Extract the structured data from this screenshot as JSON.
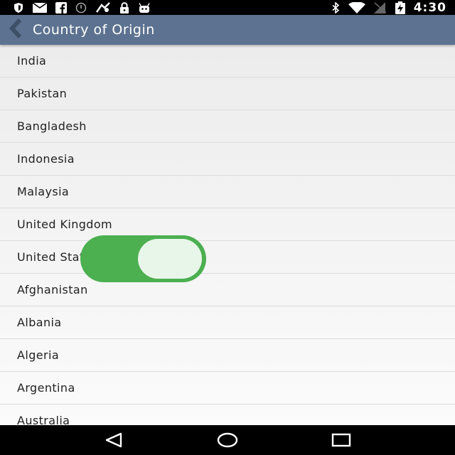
{
  "status_bar": {
    "left_icons": [
      "shield-icon",
      "mail-icon",
      "facebook-icon",
      "sync-icon",
      "fake-gps-icon",
      "lock-icon",
      "android-icon"
    ],
    "right_icons": [
      "bluetooth-icon",
      "wifi-icon",
      "signal-off-icon",
      "battery-charging-icon"
    ],
    "time": "4:30"
  },
  "toolbar": {
    "title": "Country of Origin",
    "back_icon": "chevron-left-icon",
    "background": "#5c7290"
  },
  "countries": [
    "India",
    "Pakistan",
    "Bangladesh",
    "Indonesia",
    "Malaysia",
    "United Kingdom",
    "United States",
    "Afghanistan",
    "Albania",
    "Algeria",
    "Argentina",
    "Australia"
  ],
  "overlay_toggle": {
    "state": "on",
    "color": "#4caf50"
  },
  "nav_bar": {
    "buttons": [
      "back-triangle-icon",
      "home-circle-icon",
      "recents-square-icon"
    ]
  }
}
